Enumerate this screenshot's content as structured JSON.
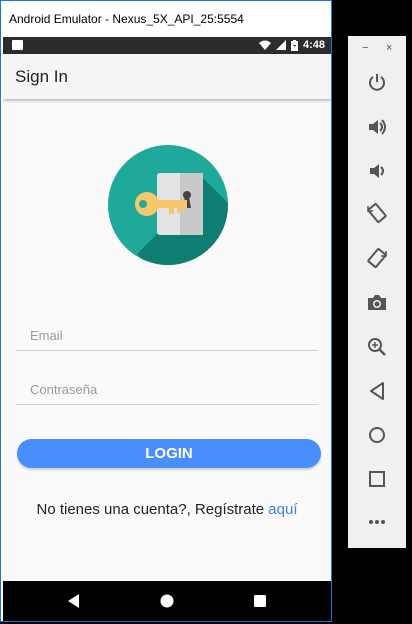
{
  "window": {
    "title": "Android Emulator - Nexus_5X_API_25:5554"
  },
  "status_bar": {
    "time": "4:48"
  },
  "app_bar": {
    "title": "Sign In"
  },
  "form": {
    "email_placeholder": "Email",
    "password_placeholder": "Contraseña",
    "login_label": "LOGIN"
  },
  "register": {
    "text": "No tienes una cuenta?, Regístrate ",
    "link": "aquí"
  },
  "navigation": {
    "buttons": [
      "back-icon",
      "home-icon",
      "overview-icon"
    ]
  },
  "emulator_panel": {
    "window_controls": [
      "−",
      "×"
    ],
    "tools": [
      "power-icon",
      "volume-up-icon",
      "volume-down-icon",
      "rotate-left-icon",
      "rotate-right-icon",
      "camera-icon",
      "zoom-icon",
      "back-icon",
      "home-icon",
      "overview-icon",
      "more-icon"
    ]
  },
  "colors": {
    "accent": "#4a8dfc",
    "link": "#3f7fe8",
    "logo_circle": "#1fa99a",
    "key": "#f7c86a"
  }
}
